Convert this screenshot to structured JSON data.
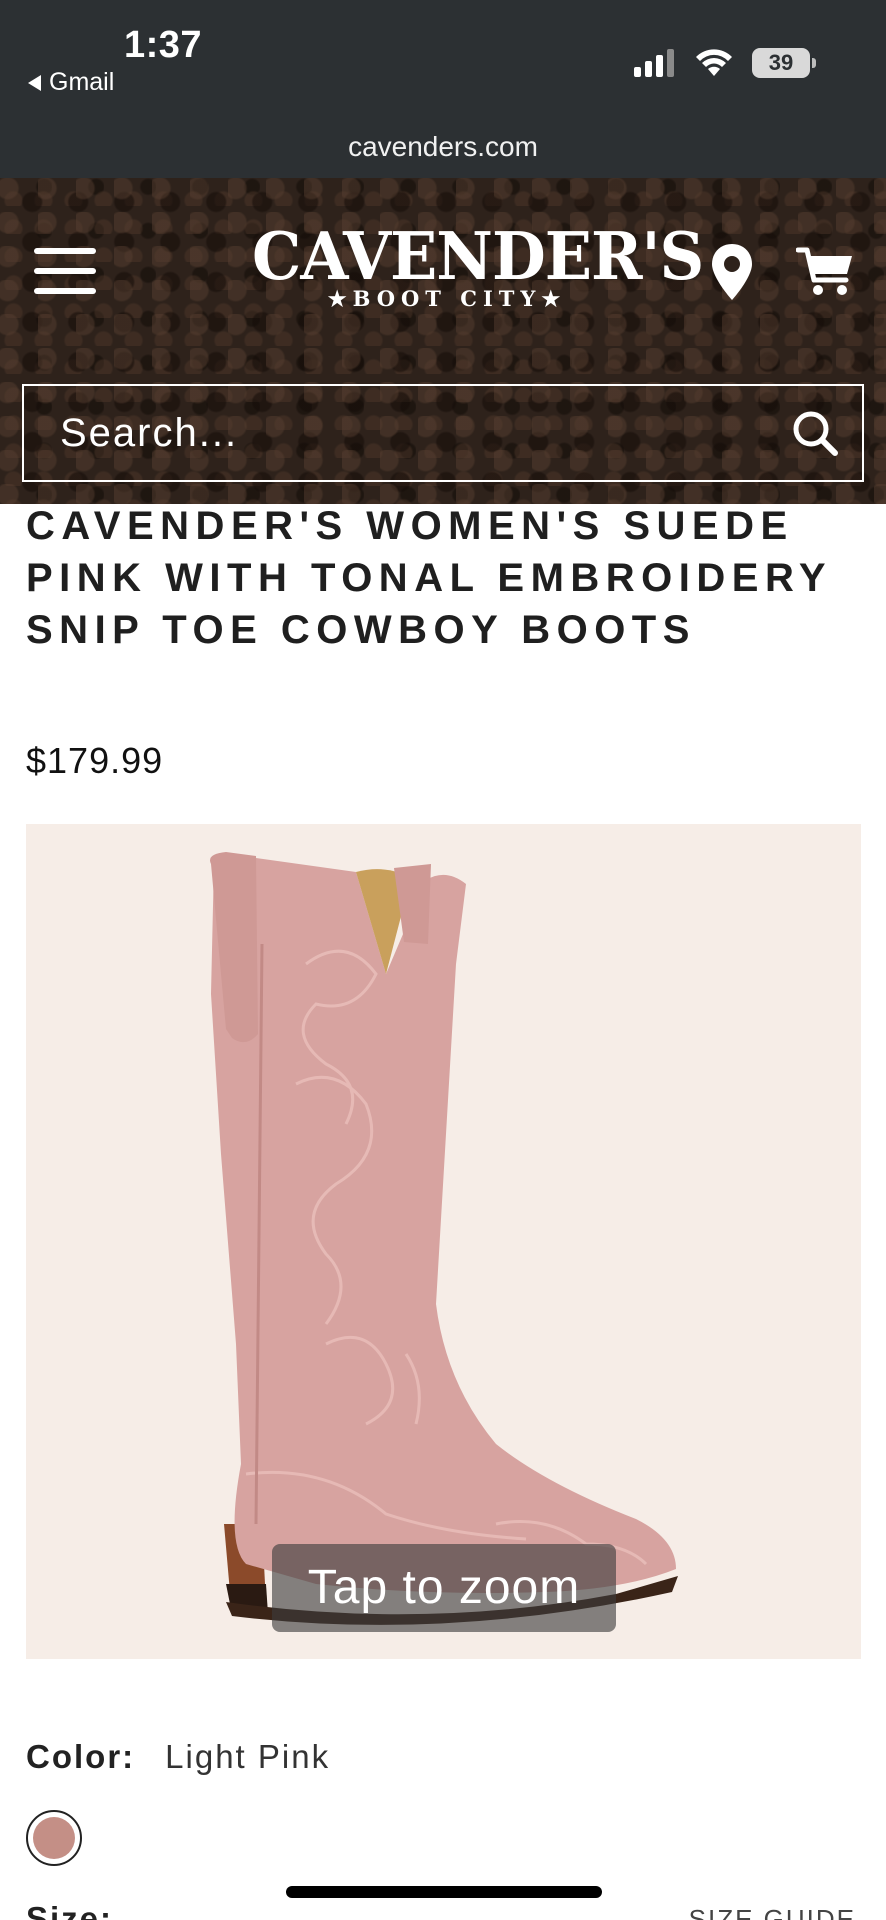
{
  "status_bar": {
    "time": "1:37",
    "back_app": "Gmail",
    "battery": "39"
  },
  "browser": {
    "url": "cavenders.com"
  },
  "header": {
    "logo_main": "CAVENDER'S",
    "logo_sub": "★BOOT CITY★",
    "search_placeholder": "Search..."
  },
  "product": {
    "title": "CAVENDER'S WOMEN'S SUEDE PINK WITH TONAL EMBROIDERY SNIP TOE COWBOY BOOTS",
    "price": "$179.99",
    "zoom_label": "Tap to zoom",
    "color_label": "Color:",
    "color_value": "Light Pink",
    "swatch_color": "#c48f86",
    "size_label": "Size:",
    "size_guide": "SIZE GUIDE"
  },
  "colors": {
    "header_bg": "#2e221b",
    "status_bg": "#2c3033",
    "image_bg": "#f6ede7",
    "boot_pink": "#d7a3a0"
  }
}
